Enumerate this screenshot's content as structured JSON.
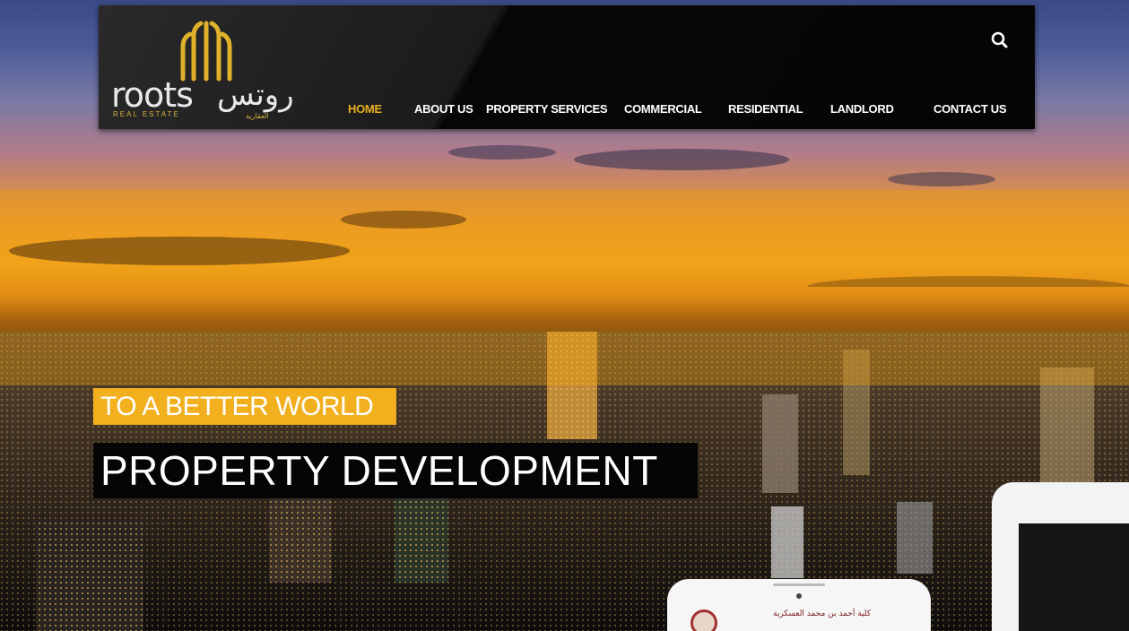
{
  "brand": {
    "name_latin": "roots",
    "sub_latin": "REAL ESTATE",
    "name_arabic": "روتس",
    "sub_arabic": "العقارية"
  },
  "nav": {
    "items": [
      {
        "label": "HOME",
        "active": true
      },
      {
        "label": "ABOUT US",
        "active": false
      },
      {
        "label": "PROPERTY SERVICES",
        "active": false
      },
      {
        "label": "COMMERCIAL",
        "active": false
      },
      {
        "label": "RESIDENTIAL",
        "active": false
      },
      {
        "label": "LANDLORD",
        "active": false
      },
      {
        "label": "CONTACT US",
        "active": false
      }
    ],
    "search_icon": "search-icon"
  },
  "hero": {
    "tagline": "TO A BETTER WORLD",
    "headline": "PROPERTY  DEVELOPMENT"
  },
  "device": {
    "phone_text": "كلية أحمد بن محمد العسكرية"
  },
  "colors": {
    "accent": "#f2b01e",
    "nav_active": "#e9b021",
    "header_bg": "#1b1b1b"
  }
}
